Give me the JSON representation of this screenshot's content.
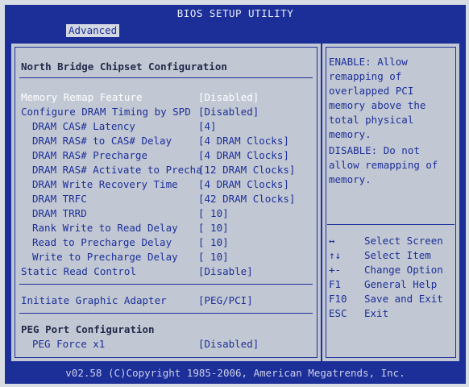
{
  "header": {
    "title": "BIOS SETUP UTILITY",
    "tab": "Advanced"
  },
  "main": {
    "section_title": "North Bridge Chipset Configuration",
    "items": [
      {
        "label": "Memory Remap Feature",
        "value": "[Disabled]"
      },
      {
        "label": "Configure DRAM Timing by SPD",
        "value": "[Disabled]"
      },
      {
        "label": "DRAM CAS# Latency",
        "value": "[4]"
      },
      {
        "label": "DRAM RAS# to CAS# Delay",
        "value": "[4 DRAM Clocks]"
      },
      {
        "label": "DRAM RAS# Precharge",
        "value": "[4 DRAM Clocks]"
      },
      {
        "label": "DRAM RAS# Activate to Precha",
        "value": "[12 DRAM Clocks]"
      },
      {
        "label": "DRAM Write Recovery Time",
        "value": "[4 DRAM Clocks]"
      },
      {
        "label": "DRAM TRFC",
        "value": "[42 DRAM Clocks]"
      },
      {
        "label": "DRAM TRRD",
        "value": "[ 10]"
      },
      {
        "label": "Rank Write to Read Delay",
        "value": "[ 10]"
      },
      {
        "label": "Read to Precharge Delay",
        "value": "[ 10]"
      },
      {
        "label": "Write to Precharge Delay",
        "value": "[ 10]"
      },
      {
        "label": "Static Read Control",
        "value": "[Disable]"
      },
      {
        "label": "Initiate Graphic Adapter",
        "value": "[PEG/PCI]"
      },
      {
        "label": "PEG Force x1",
        "value": "[Disabled]"
      }
    ],
    "peg_section_title": "PEG Port Configuration"
  },
  "help": {
    "enable_text": "ENABLE: Allow remapping of overlapped PCI memory above the total physical memory.",
    "disable_text": "DISABLE: Do not allow remapping of memory.",
    "keys": [
      {
        "key": "↔",
        "action": "Select Screen"
      },
      {
        "key": "↑↓",
        "action": "Select Item"
      },
      {
        "key": "+-",
        "action": "Change Option"
      },
      {
        "key": "F1",
        "action": "General Help"
      },
      {
        "key": "F10",
        "action": "Save and Exit"
      },
      {
        "key": "ESC",
        "action": "Exit"
      }
    ]
  },
  "footer": {
    "copyright": "v02.58 (C)Copyright 1985-2006, American Megatrends, Inc."
  },
  "colors": {
    "bios_blue": "#1c2f99",
    "panel_gray": "#c2c8d3",
    "highlight_white": "#ffffff"
  }
}
